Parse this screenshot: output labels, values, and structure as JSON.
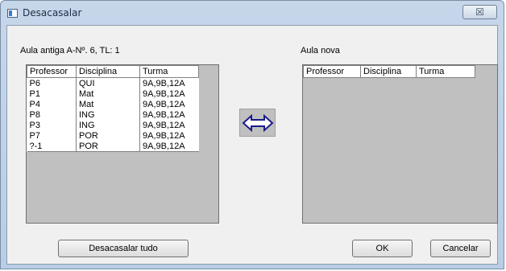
{
  "window": {
    "title": "Desacasalar",
    "close_glyph": "☒"
  },
  "left": {
    "label": "Aula antiga  A-Nº. 6, TL: 1",
    "columns": [
      "Professor",
      "Disciplina",
      "Turma"
    ],
    "rows": [
      [
        "P6",
        "QUI",
        "9A,9B,12A"
      ],
      [
        "P1",
        "Mat",
        "9A,9B,12A"
      ],
      [
        "P4",
        "Mat",
        "9A,9B,12A"
      ],
      [
        "P8",
        "ING",
        "9A,9B,12A"
      ],
      [
        "P3",
        "ING",
        "9A,9B,12A"
      ],
      [
        "P7",
        "POR",
        "9A,9B,12A"
      ],
      [
        "?-1",
        "POR",
        "9A,9B,12A"
      ]
    ]
  },
  "right": {
    "label": "Aula nova",
    "columns": [
      "Professor",
      "Disciplina",
      "Turma"
    ],
    "rows": []
  },
  "swap": {
    "icon": "swap-arrows-icon",
    "color": "#1a1a8c"
  },
  "buttons": {
    "uncouple_all": "Desacasalar tudo",
    "ok": "OK",
    "cancel": "Cancelar"
  }
}
